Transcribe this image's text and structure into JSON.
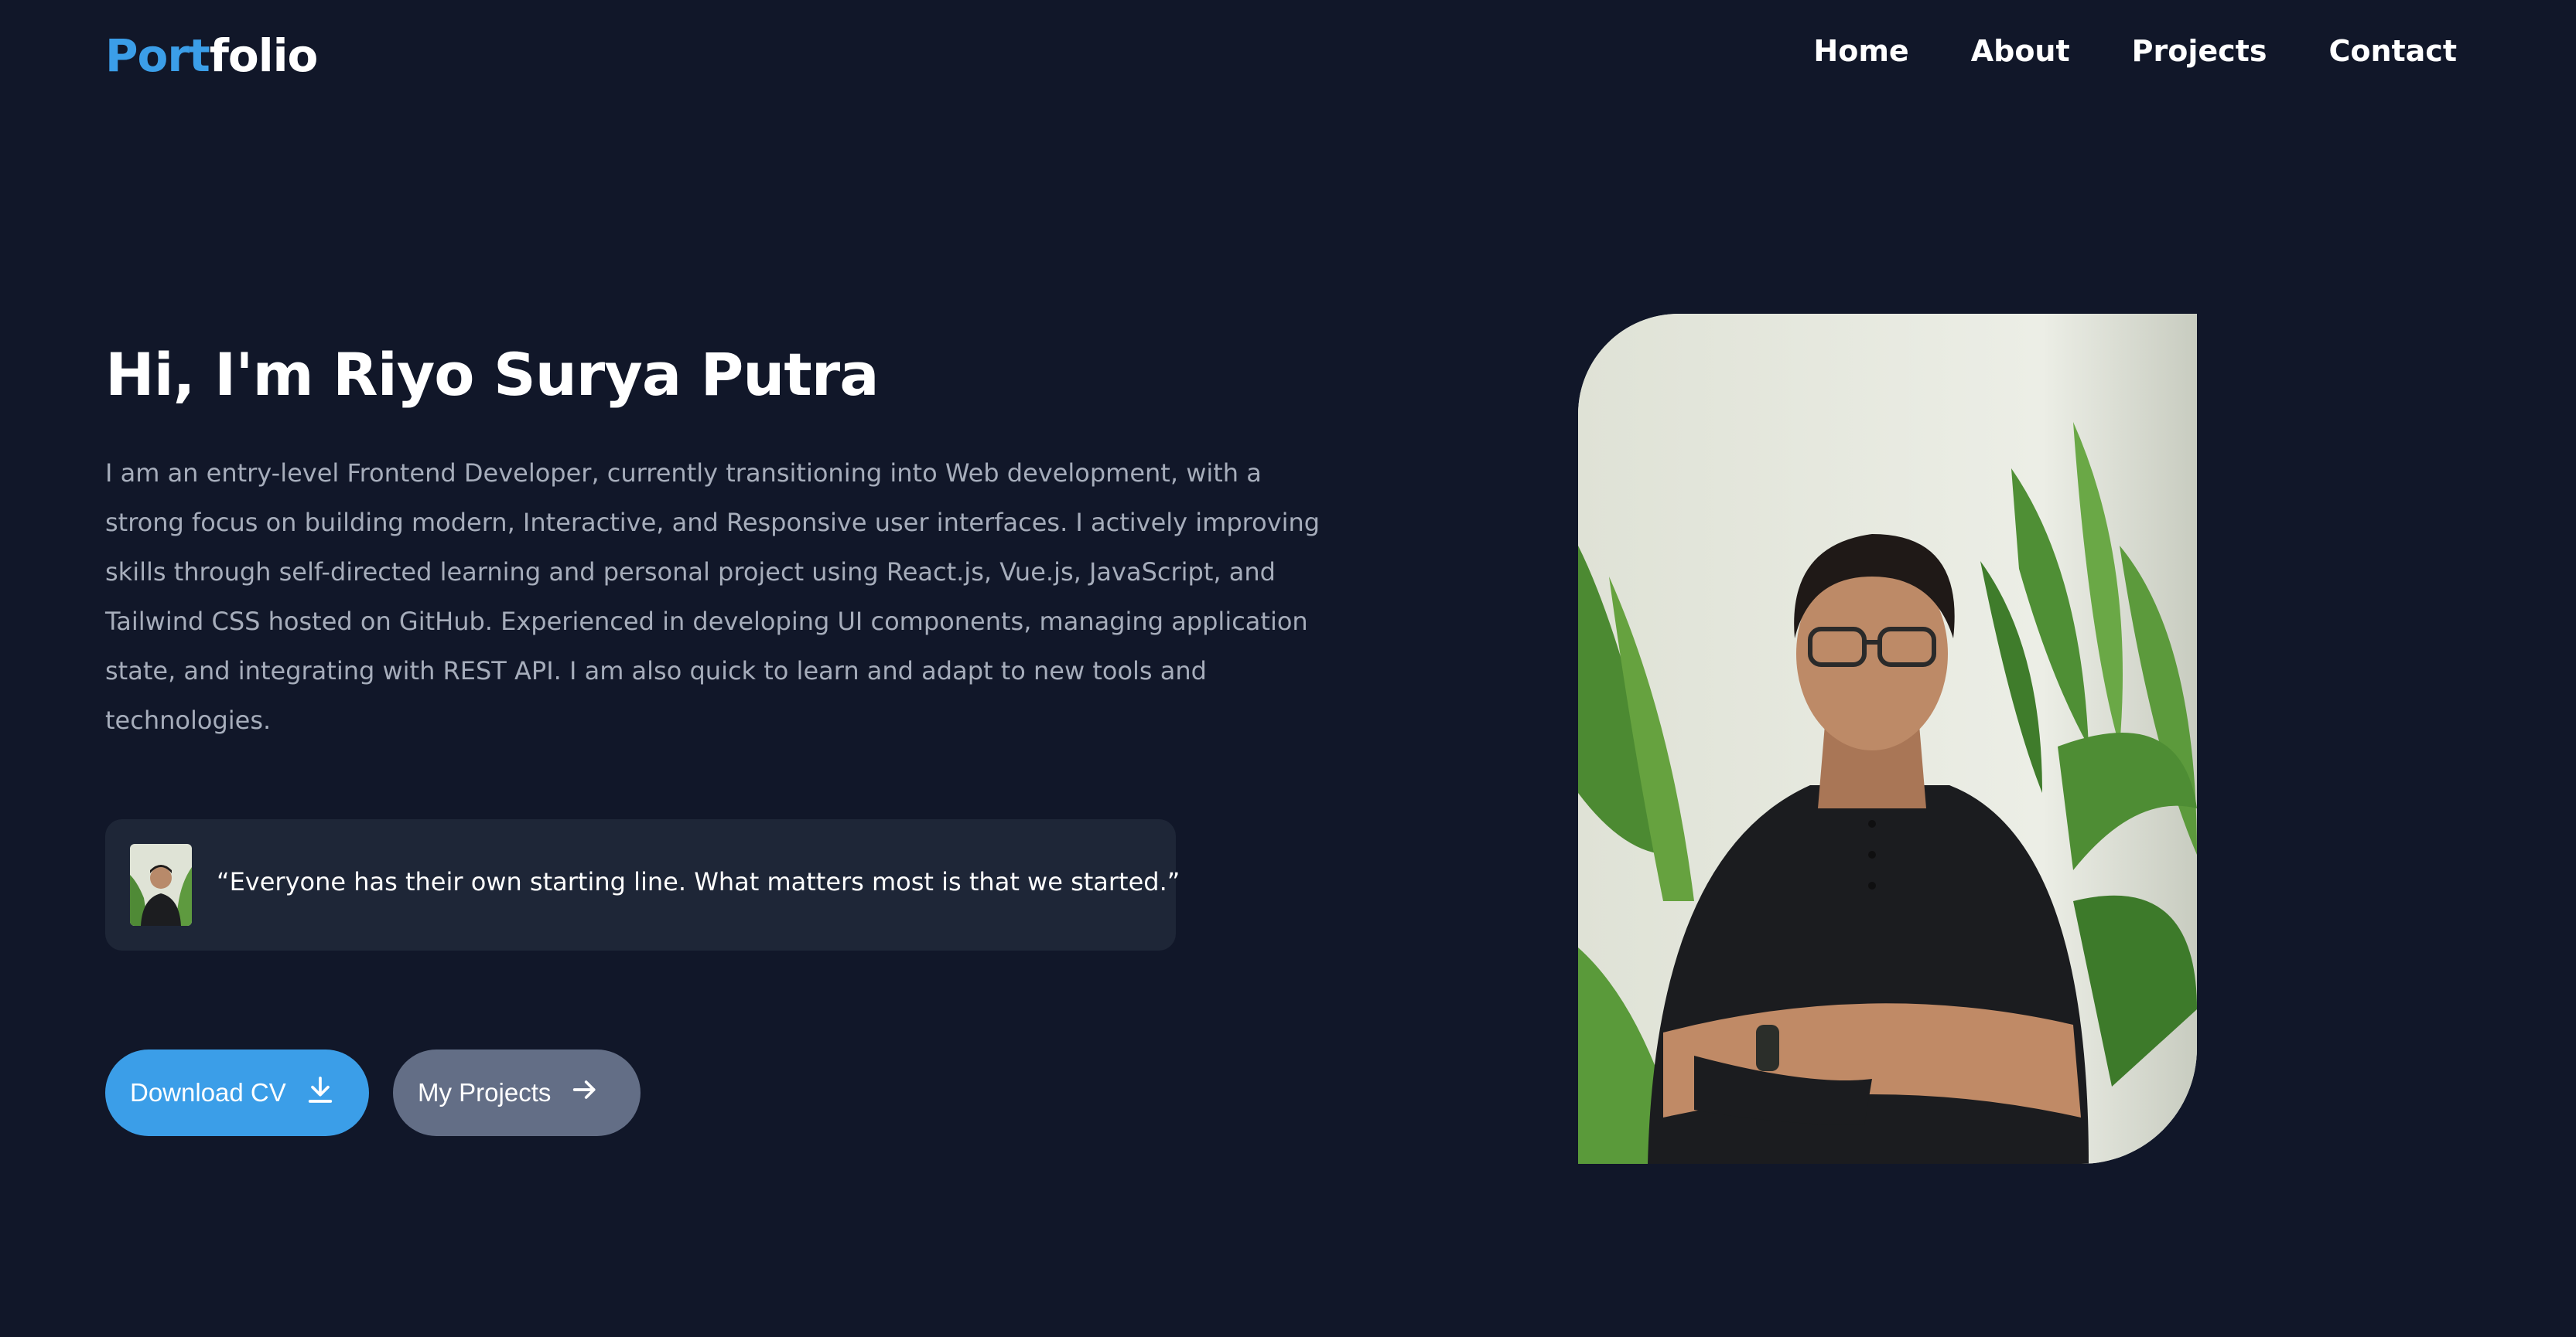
{
  "logo": {
    "accent": "Port",
    "rest": "folio"
  },
  "nav": {
    "items": [
      "Home",
      "About",
      "Projects",
      "Contact"
    ]
  },
  "hero": {
    "title": "Hi, I'm Riyo Surya Putra",
    "bio": "I am an entry-level Frontend Developer, currently transitioning into Web development, with a strong focus on building modern, Interactive, and Responsive user interfaces. I actively improving skills through self-directed learning and personal project using React.js, Vue.js, JavaScript, and Tailwind CSS hosted on GitHub. Experienced in developing UI components, managing application state, and integrating with REST API. I am also quick to learn and adapt to new tools and technologies.",
    "quote": "“Everyone has their own starting line. What matters most is that we started.”"
  },
  "buttons": {
    "download": "Download CV",
    "projects": "My Projects"
  },
  "icons": {
    "download": "download-icon",
    "arrow": "arrow-right-icon"
  },
  "colors": {
    "background": "#111729",
    "accent": "#3b9ee8",
    "card": "#1e2637",
    "secondary_button": "#636e86",
    "muted_text": "#a6adbb"
  }
}
